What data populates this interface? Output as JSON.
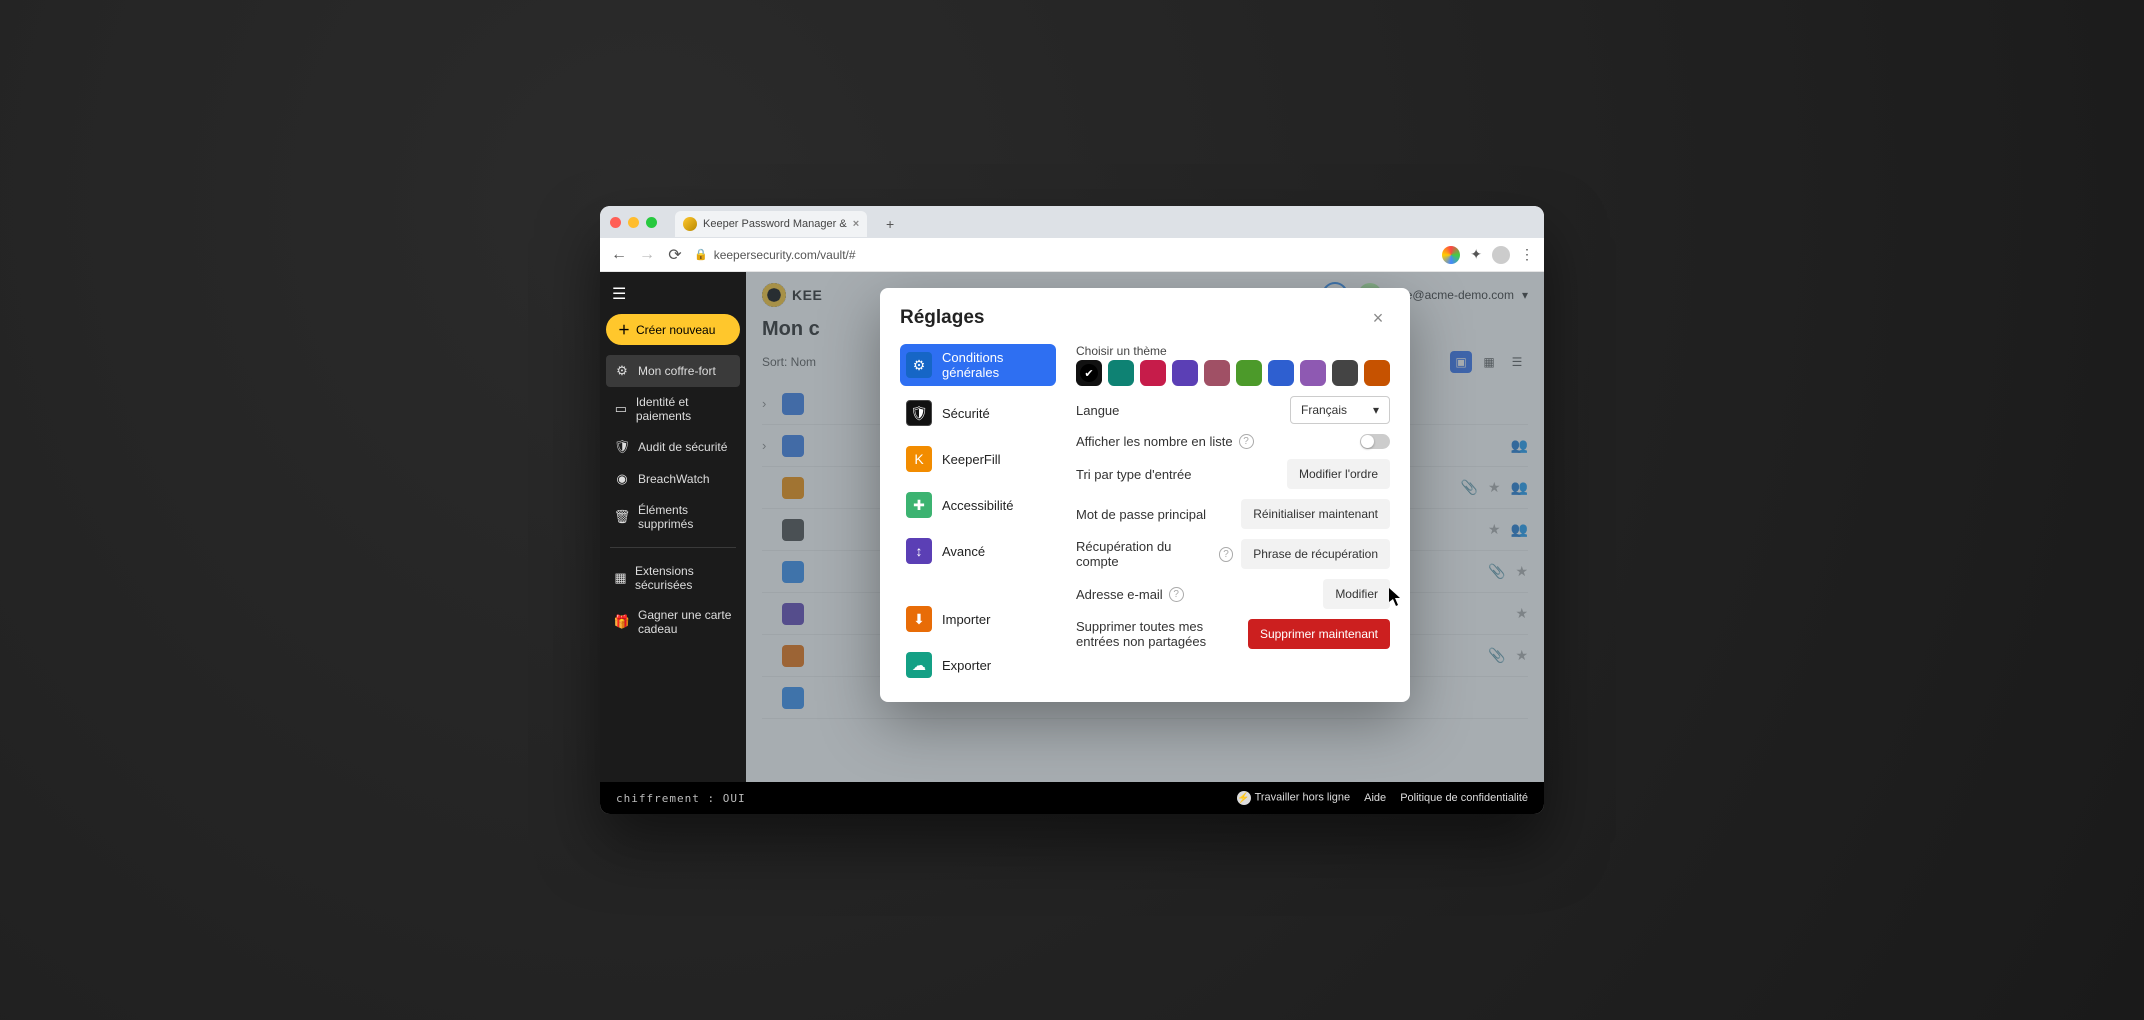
{
  "browser": {
    "traffic_lights": {
      "red": "#ff5f56",
      "yellow": "#ffbd2e",
      "green": "#27c93f"
    },
    "tab_title": "Keeper Password Manager &",
    "new_tab_glyph": "+",
    "nav": {
      "back": "←",
      "forward": "→",
      "reload": "⟳"
    },
    "lock_glyph": "🔒",
    "url": "keepersecurity.com/vault/#",
    "menu_glyph": "⋮"
  },
  "header": {
    "logo_text": "KEE",
    "user_email": "jane@acme-demo.com",
    "user_caret": "▾"
  },
  "sidebar": {
    "create_label": "Créer nouveau",
    "items": [
      {
        "icon": "⚙",
        "label": "Mon coffre-fort",
        "active": true
      },
      {
        "icon": "▭",
        "label": "Identité et paiements"
      },
      {
        "icon": "🛡",
        "label": "Audit de sécurité"
      },
      {
        "icon": "◉",
        "label": "BreachWatch"
      },
      {
        "icon": "🗑",
        "label": "Éléments supprimés"
      }
    ],
    "items2": [
      {
        "icon": "▦",
        "label": "Extensions sécurisées"
      },
      {
        "icon": "🎁",
        "label": "Gagner une carte cadeau"
      }
    ]
  },
  "page": {
    "title": "Mon c",
    "sort_label": "Sort: Nom"
  },
  "dialog": {
    "title": "Réglages",
    "nav": [
      {
        "icon": "⚙",
        "label": "Conditions générales",
        "color": "c-blue",
        "active": true
      },
      {
        "icon": "🛡",
        "label": "Sécurité",
        "color": "c-black"
      },
      {
        "icon": "K",
        "label": "KeeperFill",
        "color": "c-orange"
      },
      {
        "icon": "✚",
        "label": "Accessibilité",
        "color": "c-green"
      },
      {
        "icon": "↕",
        "label": "Avancé",
        "color": "c-purple"
      }
    ],
    "nav2": [
      {
        "icon": "⬇",
        "label": "Importer",
        "color": "c-orange2"
      },
      {
        "icon": "☁",
        "label": "Exporter",
        "color": "c-teal"
      }
    ],
    "theme_label": "Choisir un thème",
    "themes": [
      "c0",
      "c1",
      "c2",
      "c3",
      "c4",
      "c5",
      "c6",
      "c7",
      "c8",
      "c9"
    ],
    "theme_selected_index": 0,
    "language_label": "Langue",
    "language_value": "Français",
    "rows": {
      "list_numbers": "Afficher les nombre en liste",
      "sort_type": "Tri par type d'entrée",
      "sort_btn": "Modifier l'ordre",
      "master_pw": "Mot de passe principal",
      "master_btn": "Réinitialiser maintenant",
      "recovery": "Récupération du compte",
      "recovery_btn": "Phrase de récupération",
      "email": "Adresse e-mail",
      "email_btn": "Modifier",
      "delete_all": "Supprimer toutes mes entrées non partagées",
      "delete_btn": "Supprimer maintenant"
    }
  },
  "status": {
    "encryption": "chiffrement : OUI",
    "offline": "Travailler hors ligne",
    "help": "Aide",
    "privacy": "Politique de confidentialité"
  },
  "row_icons": {
    "attach": "📎",
    "star": "★",
    "share": "👥"
  }
}
